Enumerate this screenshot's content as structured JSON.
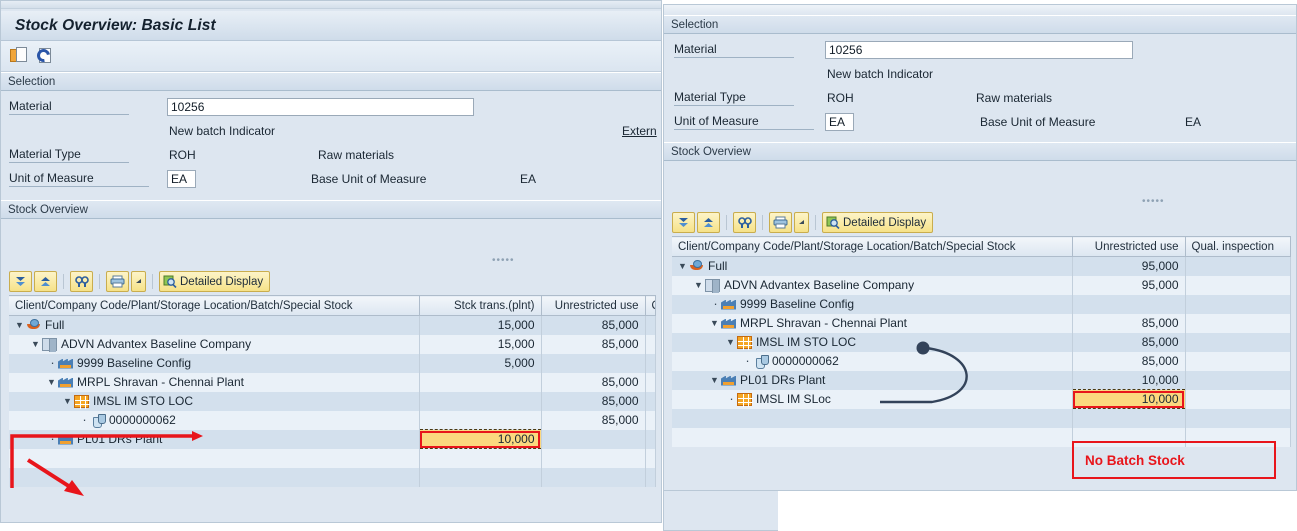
{
  "left_window": {
    "title": "Stock Overview: Basic List",
    "app_toolbar": [
      {
        "name": "create-copy-icon",
        "label": ""
      },
      {
        "name": "refresh-icon",
        "label": ""
      }
    ],
    "selection": {
      "group_label": "Selection",
      "material_label": "Material",
      "material_value": "10256",
      "material_placeholder": "Material",
      "new_batch_indicator": "New batch Indicator",
      "external_link": "Extern",
      "material_type_label": "Material Type",
      "material_type_value": "ROH",
      "material_type_text": "Raw materials",
      "unit_label": "Unit of Measure",
      "unit_value": "EA",
      "base_unit_label": "Base Unit of Measure",
      "base_unit_value": "EA"
    },
    "stock_overview": {
      "group_label": "Stock Overview",
      "toolbar": {
        "expand_all": "expand-all-icon",
        "collapse_all": "collapse-all-icon",
        "find": "find-icon",
        "print": "print-icon",
        "print_menu": "dropdown-arrow-icon",
        "detailed_display_icon": "detailed-display-icon",
        "detailed_display_label": "Detailed Display"
      },
      "columns": [
        "Client/Company Code/Plant/Storage Location/Batch/Special Stock",
        "Stck trans.(plnt)",
        "Unrestricted use",
        "Qu"
      ],
      "rows": [
        {
          "level": 0,
          "twisty": "open",
          "icon": "client-icon",
          "label": "Full",
          "stck_trans": "15,000",
          "unrestricted": "85,000"
        },
        {
          "level": 1,
          "twisty": "open",
          "icon": "company-icon",
          "label": "ADVN Advantex Baseline Company",
          "stck_trans": "15,000",
          "unrestricted": "85,000"
        },
        {
          "level": 2,
          "twisty": "leaf",
          "icon": "plant-icon",
          "label": "9999 Baseline Config",
          "stck_trans": "5,000",
          "unrestricted": ""
        },
        {
          "level": 2,
          "twisty": "open",
          "icon": "plant-icon",
          "label": "MRPL Shravan - Chennai Plant",
          "stck_trans": "",
          "unrestricted": "85,000"
        },
        {
          "level": 3,
          "twisty": "open",
          "icon": "sloc-icon",
          "label": "IMSL IM STO LOC",
          "stck_trans": "",
          "unrestricted": "85,000"
        },
        {
          "level": 4,
          "twisty": "leaf",
          "icon": "batch-icon",
          "label": "0000000062",
          "stck_trans": "",
          "unrestricted": "85,000"
        },
        {
          "level": 2,
          "twisty": "leaf",
          "icon": "plant-icon",
          "label": "PL01 DRs Plant",
          "stck_trans": "10,000",
          "unrestricted": "",
          "highlight": "stck_trans"
        }
      ]
    }
  },
  "right_window": {
    "selection": {
      "group_label": "Selection",
      "material_label": "Material",
      "material_value": "10256",
      "material_placeholder": "Material",
      "new_batch_indicator": "New batch Indicator",
      "material_type_label": "Material Type",
      "material_type_value": "ROH",
      "material_type_text": "Raw materials",
      "unit_label": "Unit of Measure",
      "unit_value": "EA",
      "base_unit_label": "Base Unit of Measure",
      "base_unit_value": "EA"
    },
    "stock_overview": {
      "group_label": "Stock Overview",
      "toolbar": {
        "expand_all": "expand-all-icon",
        "collapse_all": "collapse-all-icon",
        "find": "find-icon",
        "print": "print-icon",
        "print_menu": "dropdown-arrow-icon",
        "detailed_display_icon": "detailed-display-icon",
        "detailed_display_label": "Detailed Display"
      },
      "columns": [
        "Client/Company Code/Plant/Storage Location/Batch/Special Stock",
        "Unrestricted use",
        "Qual. inspection"
      ],
      "rows": [
        {
          "level": 0,
          "twisty": "open",
          "icon": "client-icon",
          "label": "Full",
          "unrestricted": "95,000",
          "qual": ""
        },
        {
          "level": 1,
          "twisty": "open",
          "icon": "company-icon",
          "label": "ADVN Advantex Baseline Company",
          "unrestricted": "95,000",
          "qual": ""
        },
        {
          "level": 2,
          "twisty": "leaf",
          "icon": "plant-icon",
          "label": "9999 Baseline Config",
          "unrestricted": "",
          "qual": ""
        },
        {
          "level": 2,
          "twisty": "open",
          "icon": "plant-icon",
          "label": "MRPL Shravan - Chennai Plant",
          "unrestricted": "85,000",
          "qual": ""
        },
        {
          "level": 3,
          "twisty": "open",
          "icon": "sloc-icon",
          "label": "IMSL IM STO LOC",
          "unrestricted": "85,000",
          "qual": ""
        },
        {
          "level": 4,
          "twisty": "leaf",
          "icon": "batch-icon",
          "label": "0000000062",
          "unrestricted": "85,000",
          "qual": ""
        },
        {
          "level": 2,
          "twisty": "open",
          "icon": "plant-icon",
          "label": "PL01 DRs Plant",
          "unrestricted": "10,000",
          "qual": ""
        },
        {
          "level": 3,
          "twisty": "leaf",
          "icon": "sloc-icon",
          "label": "IMSL IM SLoc",
          "unrestricted": "10,000",
          "qual": "",
          "highlight": "unrestricted"
        }
      ]
    },
    "annotation": {
      "no_batch_stock": "No Batch Stock"
    }
  },
  "colors": {
    "accent_red": "#e8151b",
    "highlight_yellow": "#fbd87f",
    "arrow_navy": "#33435a",
    "row_odd": "#d3e0ed",
    "row_even": "#eaf1f8"
  }
}
